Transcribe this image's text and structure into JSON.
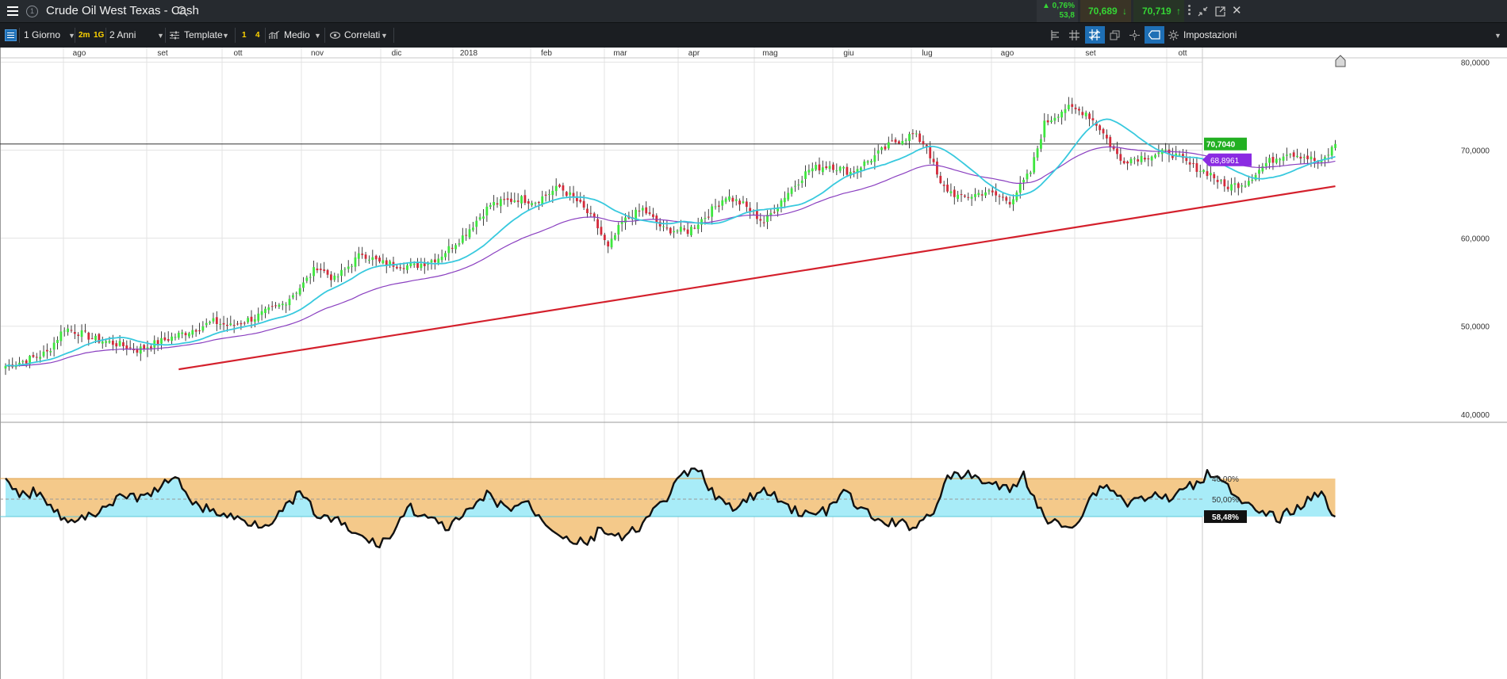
{
  "header": {
    "menu_icon": "hamburger-menu-icon",
    "info_icon": "info-circle-icon",
    "title": "Crude Oil West Texas - Cash",
    "search_icon": "search-icon",
    "change_pct": "▲ 0,76%",
    "change_abs": "53,8",
    "sell_price": "70,689",
    "buy_price": "70,719"
  },
  "toolbar": {
    "timeframe": "1 Giorno",
    "quick_2m": "2m",
    "quick_1g": "1G",
    "range": "2 Anni",
    "template_label": "Template",
    "layout_1": "1",
    "layout_4": "4",
    "indicator_label": "Medio",
    "correlated_label": "Correlati",
    "settings_label": "Impostazioni"
  },
  "colors": {
    "up": "#3ee63e",
    "down": "#d42a3a",
    "sma_fast": "#38c9de",
    "sma_slow": "#8a3fc0",
    "trendline": "#d4202c",
    "rsi_fill_upper": "#a8ecf8",
    "rsi_fill_lower": "#f4c98a",
    "price_badge": "#22b022",
    "ma_badge": "#8a2be2"
  },
  "chart_data": [
    {
      "type": "candlestick",
      "x_labels": [
        "ago",
        "set",
        "ott",
        "nov",
        "dic",
        "2018",
        "feb",
        "mar",
        "apr",
        "mag",
        "giu",
        "lug",
        "ago",
        "set",
        "ott"
      ],
      "y_ticks": [
        "80,0000",
        "70,0000",
        "60,0000",
        "50,0000",
        "40,0000"
      ],
      "ylim": [
        40,
        80
      ],
      "last_price_label": "70,7040",
      "ma_label": "68,8961",
      "anchors": [
        [
          0,
          45.5
        ],
        [
          5,
          46
        ],
        [
          12,
          47
        ],
        [
          17,
          49.8
        ],
        [
          21,
          49.3
        ],
        [
          26,
          48.5
        ],
        [
          32,
          48
        ],
        [
          38,
          47.3
        ],
        [
          45,
          48.3
        ],
        [
          52,
          49.3
        ],
        [
          60,
          50.5
        ],
        [
          65,
          50
        ],
        [
          72,
          51
        ],
        [
          80,
          52.5
        ],
        [
          86,
          54.8
        ],
        [
          90,
          56.8
        ],
        [
          95,
          55.3
        ],
        [
          103,
          58.3
        ],
        [
          108,
          57.2
        ],
        [
          118,
          56.8
        ],
        [
          125,
          57.8
        ],
        [
          132,
          60.2
        ],
        [
          140,
          63.8
        ],
        [
          148,
          64.5
        ],
        [
          153,
          64.2
        ],
        [
          160,
          65.8
        ],
        [
          165,
          64.2
        ],
        [
          170,
          62
        ],
        [
          174,
          58.8
        ],
        [
          178,
          61.8
        ],
        [
          184,
          63.3
        ],
        [
          190,
          61
        ],
        [
          197,
          60.8
        ],
        [
          203,
          62.8
        ],
        [
          208,
          64.8
        ],
        [
          213,
          63.8
        ],
        [
          219,
          61.8
        ],
        [
          225,
          64.8
        ],
        [
          232,
          67.8
        ],
        [
          238,
          68.3
        ],
        [
          244,
          67.5
        ],
        [
          250,
          69
        ],
        [
          256,
          70.8
        ],
        [
          262,
          71.8
        ],
        [
          266,
          70.5
        ],
        [
          270,
          66
        ],
        [
          276,
          64.5
        ],
        [
          283,
          65.3
        ],
        [
          290,
          64.2
        ],
        [
          296,
          67.5
        ],
        [
          300,
          73
        ],
        [
          306,
          74.8
        ],
        [
          312,
          74.3
        ],
        [
          316,
          72.5
        ],
        [
          322,
          68.8
        ],
        [
          329,
          69.3
        ],
        [
          336,
          69.8
        ],
        [
          342,
          68.3
        ],
        [
          348,
          67.3
        ],
        [
          352,
          65.8
        ],
        [
          358,
          66.3
        ],
        [
          364,
          68.5
        ],
        [
          370,
          69.8
        ],
        [
          375,
          69.3
        ],
        [
          380,
          68.5
        ],
        [
          384,
          70.7
        ]
      ],
      "trendline": [
        [
          50,
          45.1
        ],
        [
          384,
          65.9
        ]
      ],
      "sma_fast_name": "",
      "sma_slow_name": ""
    },
    {
      "type": "line",
      "indicator": "RSI",
      "levels": [
        58.48,
        50,
        40
      ],
      "level_labels": [
        "58,48%",
        "50,00%",
        "40,00%"
      ],
      "ylim": [
        30,
        80
      ],
      "anchors": [
        [
          0,
          42
        ],
        [
          5,
          48
        ],
        [
          10,
          46
        ],
        [
          15,
          57
        ],
        [
          20,
          62
        ],
        [
          25,
          57
        ],
        [
          30,
          52
        ],
        [
          36,
          48
        ],
        [
          40,
          50
        ],
        [
          45,
          43
        ],
        [
          50,
          41
        ],
        [
          55,
          53
        ],
        [
          62,
          57
        ],
        [
          70,
          61
        ],
        [
          75,
          62
        ],
        [
          80,
          56
        ],
        [
          85,
          47
        ],
        [
          90,
          58
        ],
        [
          96,
          61
        ],
        [
          101,
          67
        ],
        [
          107,
          72
        ],
        [
          112,
          67
        ],
        [
          116,
          53
        ],
        [
          122,
          60
        ],
        [
          128,
          64
        ],
        [
          134,
          56
        ],
        [
          139,
          48
        ],
        [
          145,
          55
        ],
        [
          150,
          51
        ],
        [
          155,
          60
        ],
        [
          162,
          69
        ],
        [
          168,
          72
        ],
        [
          172,
          64
        ],
        [
          178,
          70
        ],
        [
          184,
          62
        ],
        [
          190,
          51
        ],
        [
          196,
          38
        ],
        [
          200,
          36
        ],
        [
          205,
          48
        ],
        [
          210,
          56
        ],
        [
          215,
          49
        ],
        [
          220,
          46
        ],
        [
          225,
          53
        ],
        [
          232,
          58
        ],
        [
          238,
          55
        ],
        [
          242,
          46
        ],
        [
          247,
          55
        ],
        [
          252,
          61
        ],
        [
          258,
          62
        ],
        [
          263,
          63
        ],
        [
          268,
          55
        ],
        [
          272,
          40
        ],
        [
          278,
          38
        ],
        [
          284,
          42
        ],
        [
          290,
          46
        ],
        [
          294,
          38
        ],
        [
          300,
          60
        ],
        [
          306,
          63
        ],
        [
          310,
          60
        ],
        [
          314,
          47
        ],
        [
          318,
          43
        ],
        [
          324,
          52
        ],
        [
          330,
          48
        ],
        [
          336,
          50
        ],
        [
          342,
          44
        ],
        [
          348,
          37
        ],
        [
          352,
          40
        ],
        [
          356,
          51
        ],
        [
          360,
          55
        ],
        [
          364,
          58
        ],
        [
          368,
          59
        ],
        [
          372,
          55
        ],
        [
          376,
          51
        ],
        [
          380,
          46
        ],
        [
          384,
          58.5
        ]
      ]
    }
  ]
}
